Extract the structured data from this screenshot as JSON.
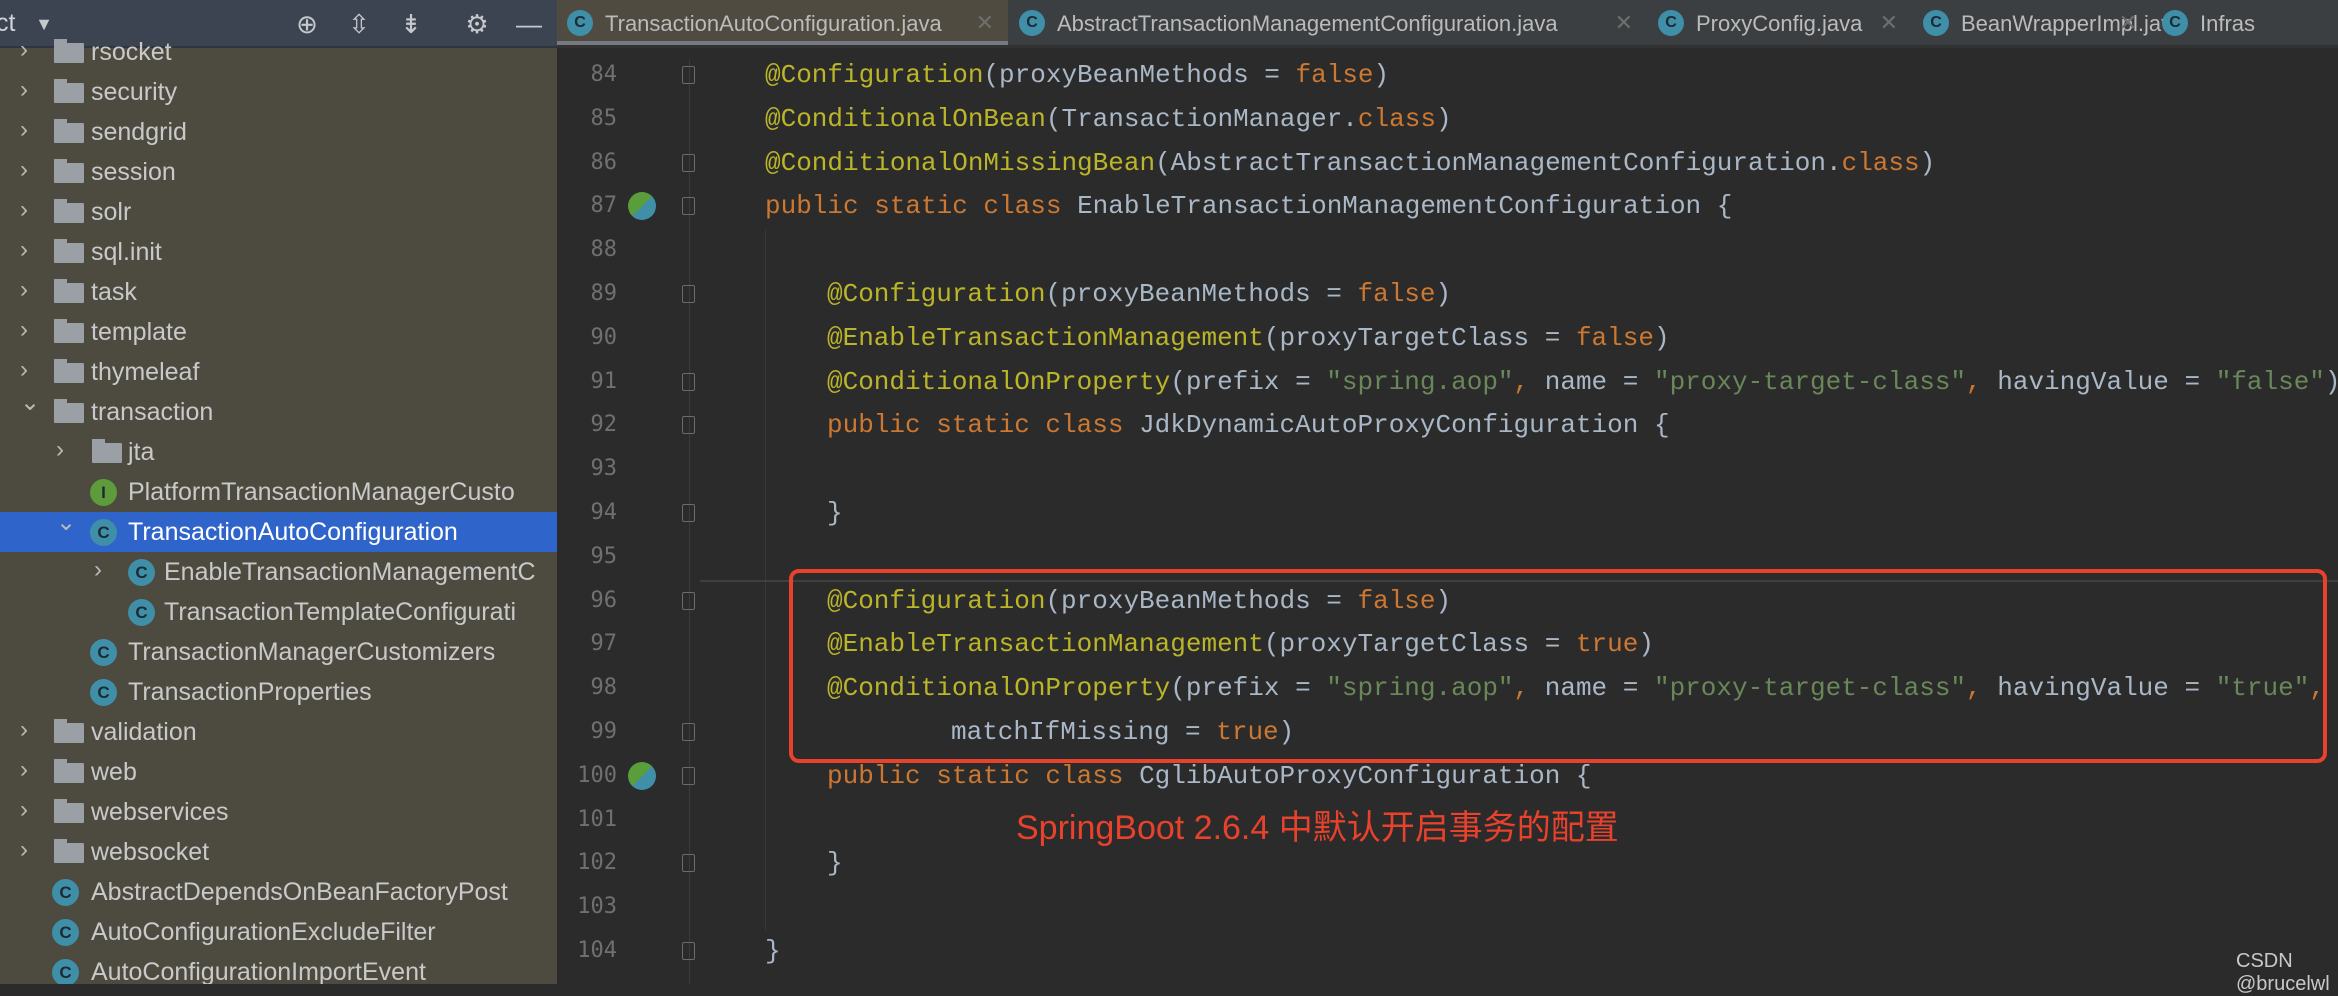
{
  "sidebar": {
    "header_title": "ct",
    "header_icons": [
      "dropdown-icon",
      "locate-icon",
      "expand-all-icon",
      "collapse-all-icon",
      "gear-icon",
      "minimize-icon"
    ],
    "items": [
      {
        "label": "rsocket",
        "type": "folder",
        "level": 1,
        "expanded": false
      },
      {
        "label": "security",
        "type": "folder",
        "level": 1,
        "expanded": false
      },
      {
        "label": "sendgrid",
        "type": "folder",
        "level": 1,
        "expanded": false
      },
      {
        "label": "session",
        "type": "folder",
        "level": 1,
        "expanded": false
      },
      {
        "label": "solr",
        "type": "folder",
        "level": 1,
        "expanded": false
      },
      {
        "label": "sql.init",
        "type": "folder",
        "level": 1,
        "expanded": false
      },
      {
        "label": "task",
        "type": "folder",
        "level": 1,
        "expanded": false
      },
      {
        "label": "template",
        "type": "folder",
        "level": 1,
        "expanded": false
      },
      {
        "label": "thymeleaf",
        "type": "folder",
        "level": 1,
        "expanded": false
      },
      {
        "label": "transaction",
        "type": "folder",
        "level": 1,
        "expanded": true
      },
      {
        "label": "jta",
        "type": "folder",
        "level": 2,
        "expanded": false
      },
      {
        "label": "PlatformTransactionManagerCusto",
        "type": "interface",
        "level": 2
      },
      {
        "label": "TransactionAutoConfiguration",
        "type": "class",
        "level": 2,
        "expanded": true,
        "selected": true
      },
      {
        "label": "EnableTransactionManagementC",
        "type": "class",
        "level": 3,
        "expanded": false
      },
      {
        "label": "TransactionTemplateConfigurati",
        "type": "class",
        "level": 3
      },
      {
        "label": "TransactionManagerCustomizers",
        "type": "class",
        "level": 2
      },
      {
        "label": "TransactionProperties",
        "type": "class",
        "level": 2
      },
      {
        "label": "validation",
        "type": "folder",
        "level": 1,
        "expanded": false
      },
      {
        "label": "web",
        "type": "folder",
        "level": 1,
        "expanded": false
      },
      {
        "label": "webservices",
        "type": "folder",
        "level": 1,
        "expanded": false
      },
      {
        "label": "websocket",
        "type": "folder",
        "level": 1,
        "expanded": false
      },
      {
        "label": "AbstractDependsOnBeanFactoryPost",
        "type": "class",
        "level": 1
      },
      {
        "label": "AutoConfigurationExcludeFilter",
        "type": "class",
        "level": 1
      },
      {
        "label": "AutoConfigurationImportEvent",
        "type": "class",
        "level": 1
      }
    ]
  },
  "tabs": [
    {
      "label": "TransactionAutoConfiguration.java",
      "active": true
    },
    {
      "label": "AbstractTransactionManagementConfiguration.java"
    },
    {
      "label": "ProxyConfig.java"
    },
    {
      "label": "BeanWrapperImpl.java"
    },
    {
      "label": "Infras"
    }
  ],
  "editor": {
    "lines": [
      {
        "n": "84",
        "indent": 0,
        "t": [
          [
            "ann",
            "@Configuration"
          ],
          [
            "pl",
            "(proxyBeanMethods = "
          ],
          [
            "kw",
            "false"
          ],
          [
            "pl",
            ")"
          ]
        ]
      },
      {
        "n": "85",
        "indent": 0,
        "t": [
          [
            "ann",
            "@ConditionalOnBean"
          ],
          [
            "pl",
            "(TransactionManager."
          ],
          [
            "kw",
            "class"
          ],
          [
            "pl",
            ")"
          ]
        ]
      },
      {
        "n": "86",
        "indent": 0,
        "t": [
          [
            "ann",
            "@ConditionalOnMissingBean"
          ],
          [
            "pl",
            "(AbstractTransactionManagementConfiguration."
          ],
          [
            "kw",
            "class"
          ],
          [
            "pl",
            ")"
          ]
        ]
      },
      {
        "n": "87",
        "indent": 0,
        "t": [
          [
            "kw",
            "public static class "
          ],
          [
            "pl",
            "EnableTransactionManagementConfiguration {"
          ]
        ]
      },
      {
        "n": "88",
        "indent": 0,
        "t": []
      },
      {
        "n": "89",
        "indent": 1,
        "t": [
          [
            "ann",
            "@Configuration"
          ],
          [
            "pl",
            "(proxyBeanMethods = "
          ],
          [
            "kw",
            "false"
          ],
          [
            "pl",
            ")"
          ]
        ]
      },
      {
        "n": "90",
        "indent": 1,
        "t": [
          [
            "ann",
            "@EnableTransactionManagement"
          ],
          [
            "pl",
            "(proxyTargetClass = "
          ],
          [
            "kw",
            "false"
          ],
          [
            "pl",
            ")"
          ]
        ]
      },
      {
        "n": "91",
        "indent": 1,
        "t": [
          [
            "ann",
            "@ConditionalOnProperty"
          ],
          [
            "pl",
            "(prefix = "
          ],
          [
            "str",
            "\"spring.aop\""
          ],
          [
            "kw",
            ", "
          ],
          [
            "pl",
            "name = "
          ],
          [
            "str",
            "\"proxy-target-class\""
          ],
          [
            "kw",
            ", "
          ],
          [
            "pl",
            "havingValue = "
          ],
          [
            "str",
            "\"false\""
          ],
          [
            "pl",
            ")"
          ]
        ]
      },
      {
        "n": "92",
        "indent": 1,
        "t": [
          [
            "kw",
            "public static class "
          ],
          [
            "pl",
            "JdkDynamicAutoProxyConfiguration {"
          ]
        ]
      },
      {
        "n": "93",
        "indent": 0,
        "t": []
      },
      {
        "n": "94",
        "indent": 1,
        "t": [
          [
            "pl",
            "}"
          ]
        ]
      },
      {
        "n": "95",
        "indent": 0,
        "t": []
      },
      {
        "n": "96",
        "indent": 1,
        "t": [
          [
            "ann",
            "@Configuration"
          ],
          [
            "pl",
            "(proxyBeanMethods = "
          ],
          [
            "kw",
            "false"
          ],
          [
            "pl",
            ")"
          ]
        ]
      },
      {
        "n": "97",
        "indent": 1,
        "t": [
          [
            "ann",
            "@EnableTransactionManagement"
          ],
          [
            "pl",
            "(proxyTargetClass = "
          ],
          [
            "kw",
            "true"
          ],
          [
            "pl",
            ")"
          ]
        ]
      },
      {
        "n": "98",
        "indent": 1,
        "t": [
          [
            "ann",
            "@ConditionalOnProperty"
          ],
          [
            "pl",
            "(prefix = "
          ],
          [
            "str",
            "\"spring.aop\""
          ],
          [
            "kw",
            ", "
          ],
          [
            "pl",
            "name = "
          ],
          [
            "str",
            "\"proxy-target-class\""
          ],
          [
            "kw",
            ", "
          ],
          [
            "pl",
            "havingValue = "
          ],
          [
            "str",
            "\"true\""
          ],
          [
            "kw",
            ","
          ]
        ]
      },
      {
        "n": "99",
        "indent": 3,
        "t": [
          [
            "pl",
            "matchIfMissing = "
          ],
          [
            "kw",
            "true"
          ],
          [
            "pl",
            ")"
          ]
        ]
      },
      {
        "n": "100",
        "indent": 1,
        "t": [
          [
            "kw",
            "public static class "
          ],
          [
            "pl",
            "CglibAutoProxyConfiguration {"
          ]
        ]
      },
      {
        "n": "101",
        "indent": 0,
        "t": []
      },
      {
        "n": "102",
        "indent": 1,
        "t": [
          [
            "pl",
            "}"
          ]
        ]
      },
      {
        "n": "103",
        "indent": 0,
        "t": []
      },
      {
        "n": "104",
        "indent": 0,
        "t": [
          [
            "pl",
            "}"
          ]
        ]
      }
    ],
    "fold_markers": [
      "84",
      "86",
      "87",
      "89",
      "91",
      "92",
      "94",
      "96",
      "99",
      "100",
      "102",
      "104"
    ],
    "gutter_icons": [
      {
        "line": "87",
        "icon": "spring-bean-icon"
      },
      {
        "line": "100",
        "icon": "spring-bean-icon"
      }
    ]
  },
  "annotation": {
    "text": "SpringBoot 2.6.4 中默认开启事务的配置",
    "color": "#e8412c"
  },
  "watermark": "CSDN @brucelwl",
  "colors": {
    "annotation": "#bbb529",
    "keyword": "#cc7832",
    "string": "#6a8759",
    "plain": "#a9b7c6",
    "selection": "#2f65ca",
    "highlight_box": "#e8412c"
  }
}
